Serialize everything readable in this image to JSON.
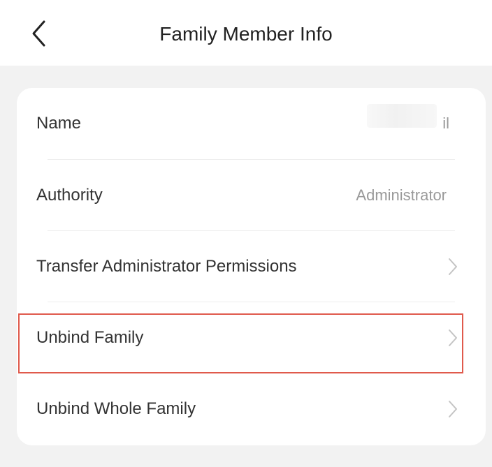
{
  "header": {
    "title": "Family Member Info",
    "back_icon": "chevron-left-icon"
  },
  "rows": [
    {
      "label": "Name",
      "value": "il"
    },
    {
      "label": "Authority",
      "value": "Administrator"
    },
    {
      "label": "Transfer Administrator Permissions"
    },
    {
      "label": "Unbind Family"
    },
    {
      "label": "Unbind Whole Family"
    }
  ],
  "colors": {
    "background": "#f2f2f2",
    "card": "#ffffff",
    "highlight": "#e05a4c",
    "secondary_text": "#9a9a9a"
  }
}
